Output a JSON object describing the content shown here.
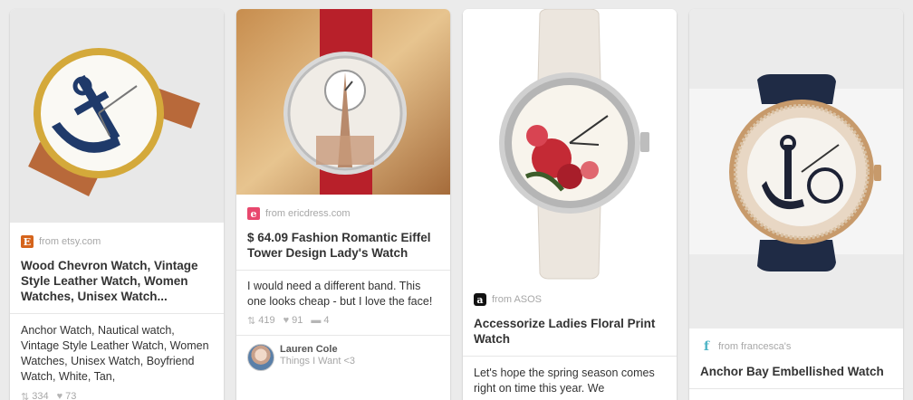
{
  "pins": [
    {
      "source_icon": {
        "name": "etsy-icon",
        "letter": "E",
        "color": "#d5641c"
      },
      "source": "from etsy.com",
      "title": "Wood Chevron Watch, Vintage Style Leather Watch, Women Watches, Unisex Watch...",
      "description": "Anchor Watch, Nautical watch, Vintage Style Leather Watch, Women Watches, Unisex Watch, Boyfriend Watch, White, Tan,",
      "repins": "334",
      "likes": "73"
    },
    {
      "source_icon": {
        "name": "ericdress-icon",
        "letter": "e",
        "color": "#e8486e"
      },
      "source": "from ericdress.com",
      "title": "$ 64.09 Fashion Romantic Eiffel Tower Design Lady's Watch",
      "description": "I would need a different band. This one looks cheap - but I love the face!",
      "repins": "419",
      "likes": "91",
      "comments": "4",
      "pinner": {
        "name": "Lauren Cole",
        "board": "Things I Want <3"
      }
    },
    {
      "source_icon": {
        "name": "asos-icon",
        "letter": "a",
        "color": "#111111"
      },
      "source": "from ASOS",
      "title": "Accessorize Ladies Floral Print Watch",
      "description": "Let's hope the spring season comes right on time this year. We"
    },
    {
      "source_icon": {
        "name": "francescas-icon",
        "letter": "f",
        "color": "#4fb5c6"
      },
      "source": "from francesca's",
      "title": "Anchor Bay Embellished Watch"
    }
  ]
}
